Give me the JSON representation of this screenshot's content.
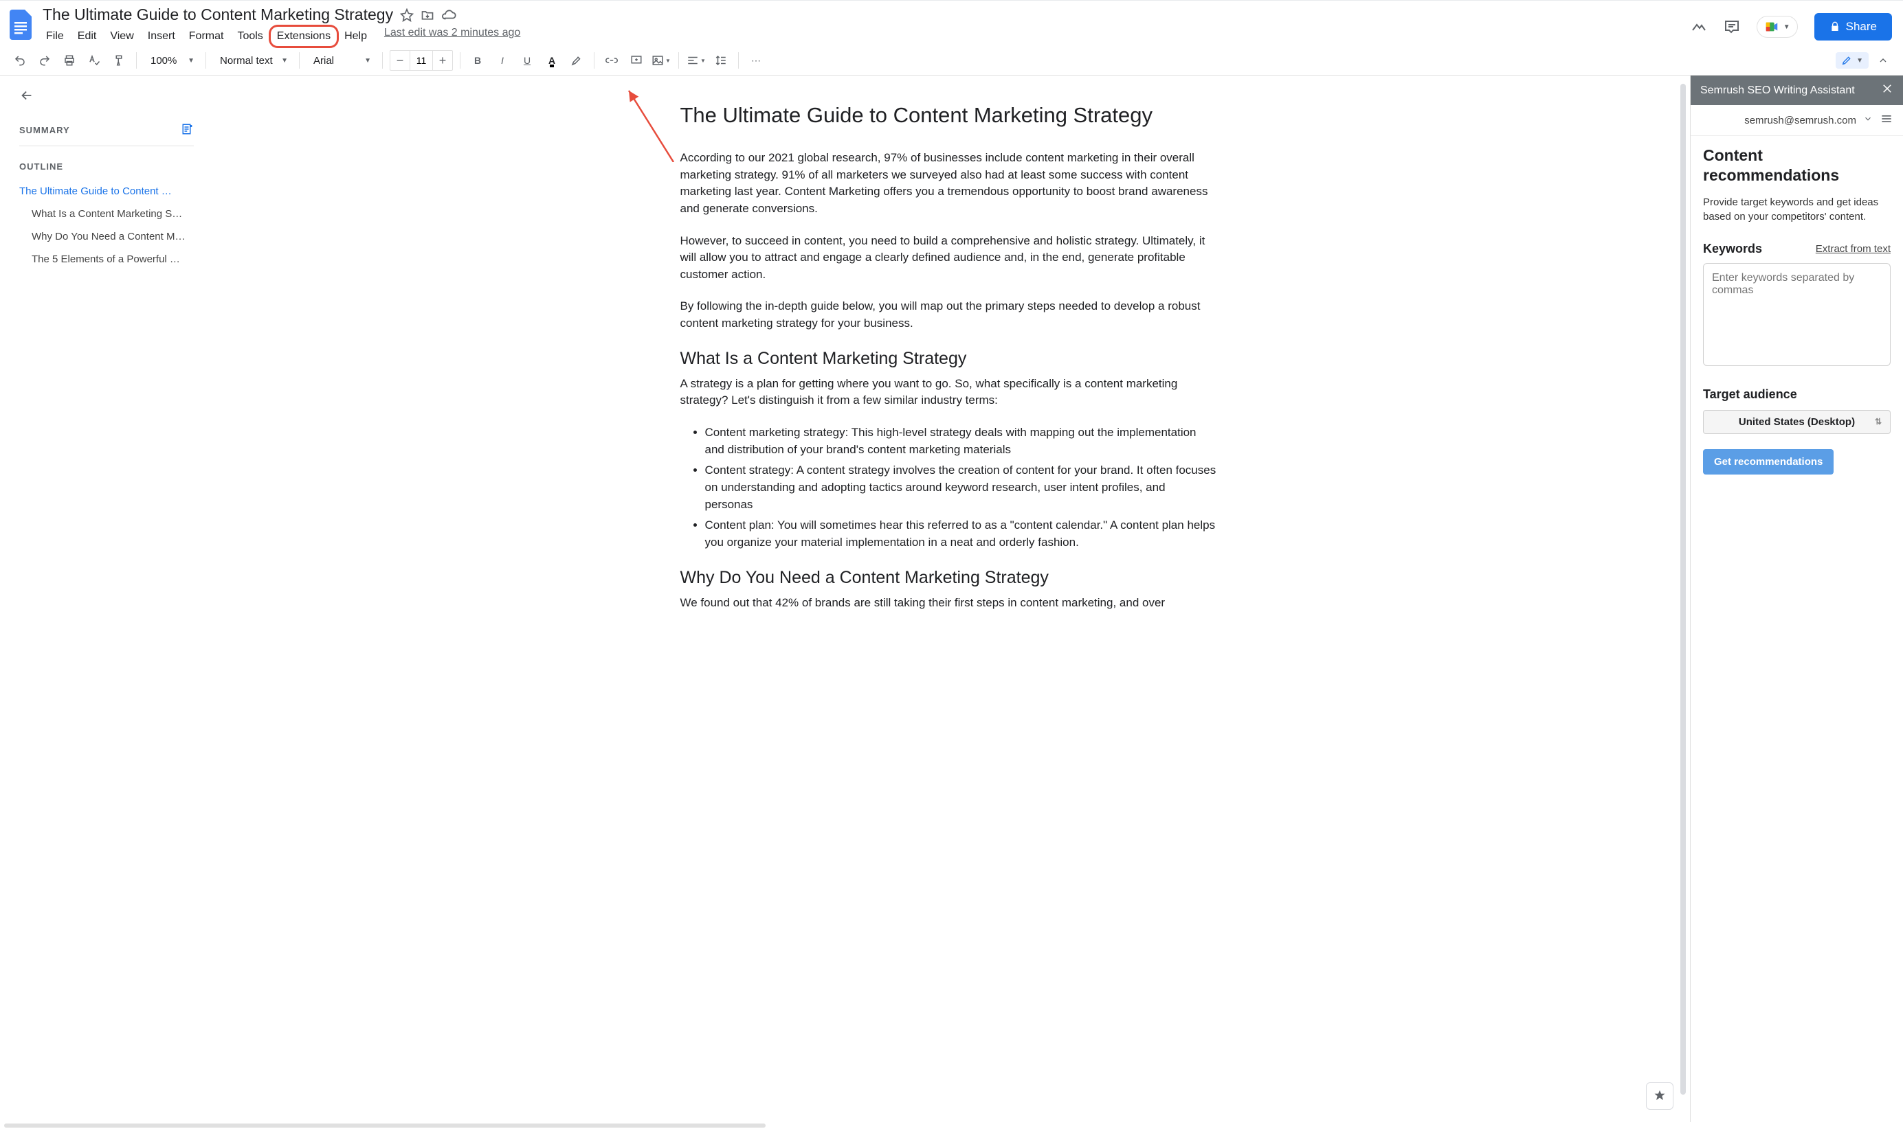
{
  "doc": {
    "title": "The Ultimate Guide to Content Marketing Strategy"
  },
  "menubar": {
    "file": "File",
    "edit": "Edit",
    "view": "View",
    "insert": "Insert",
    "format": "Format",
    "tools": "Tools",
    "extensions": "Extensions",
    "help": "Help",
    "status": "Last edit was 2 minutes ago"
  },
  "toolbar": {
    "zoom": "100%",
    "paragraph_style": "Normal text",
    "font": "Arial",
    "font_size": "11"
  },
  "share_label": "Share",
  "outline": {
    "summary_label": "SUMMARY",
    "outline_label": "OUTLINE",
    "items": [
      {
        "text": "The Ultimate Guide to Content …",
        "level": 1
      },
      {
        "text": "What Is a Content Marketing S…",
        "level": 2
      },
      {
        "text": "Why Do You Need a Content M…",
        "level": 2
      },
      {
        "text": "The 5 Elements of a Powerful …",
        "level": 2
      }
    ]
  },
  "content": {
    "h1": "The Ultimate Guide to Content Marketing Strategy",
    "p1": "According to our 2021 global research, 97% of businesses include content marketing in their overall marketing strategy. 91% of all marketers we surveyed also had at least some success with content marketing last year. Content Marketing offers you a tremendous opportunity to boost brand awareness and generate conversions.",
    "p2": "However, to succeed in content, you need to build a comprehensive and holistic strategy. Ultimately, it will allow you to attract and engage a clearly defined audience and, in the end, generate profitable customer action.",
    "p3": "By following the in-depth guide below, you will map out the primary steps needed to develop a robust content marketing strategy for your business.",
    "h2a": "What Is a Content Marketing Strategy",
    "p4": "A strategy is a plan for getting where you want to go. So, what specifically is a content marketing strategy? Let's distinguish it from a few similar industry terms:",
    "li1": "Content marketing strategy: This high-level strategy deals with mapping out the implementation and distribution of your brand's content marketing materials",
    "li2": "Content strategy: A content strategy involves the creation of content for your brand. It often focuses on understanding and adopting tactics around keyword research, user intent profiles, and personas",
    "li3": "Content plan: You will sometimes hear this referred to as a \"content calendar.\" A content plan helps you organize your material implementation in a neat and orderly fashion.",
    "h2b": "Why Do You Need a Content Marketing Strategy",
    "p5": "We found out that 42% of brands are still taking their first steps in content marketing, and over"
  },
  "panel": {
    "header": "Semrush SEO Writing Assistant",
    "account": "semrush@semrush.com",
    "title": "Content recommendations",
    "desc": "Provide target keywords and get ideas based on your competitors' content.",
    "keywords_label": "Keywords",
    "extract_link": "Extract from text",
    "keywords_placeholder": "Enter keywords separated by commas",
    "audience_label": "Target audience",
    "audience_value": "United States (Desktop)",
    "cta": "Get recommendations"
  }
}
